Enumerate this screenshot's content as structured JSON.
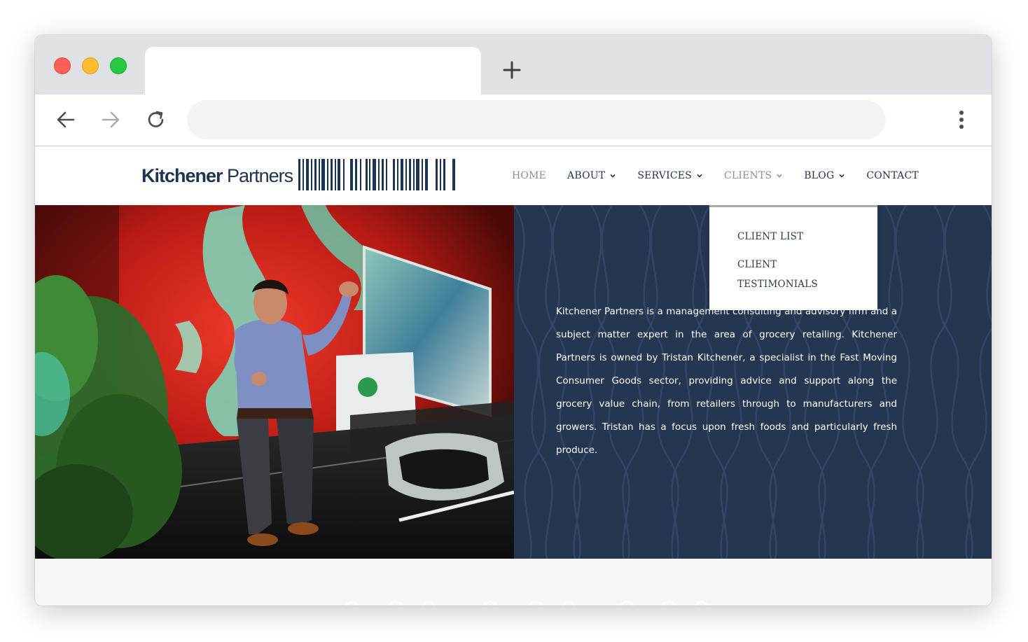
{
  "browser": {
    "new_tab_icon": "plus-icon",
    "back_icon": "arrow-left-icon",
    "forward_icon": "arrow-right-icon",
    "reload_icon": "reload-icon",
    "menu_icon": "kebab-menu-icon",
    "address_value": ""
  },
  "site": {
    "logo": {
      "bold": "Kitchener",
      "light": " Partners"
    },
    "nav": {
      "home": "HOME",
      "about": "ABOUT",
      "services": "SERVICES",
      "clients": "CLIENTS",
      "blog": "BLOG",
      "contact": "CONTACT"
    },
    "clients_dropdown": {
      "item1": "CLIENT LIST",
      "item2_line1": "CLIENT",
      "item2_line2": "TESTIMONIALS"
    },
    "about_text": "Kitchener Partners is a management consulting and advisory firm and a subject matter expert in the area of grocery retailing. Kitchener Partners is owned by Tristan Kitchener, a specialist in the Fast Moving Consumer Goods sector, providing advice and support along the grocery value chain, from retailers through to manufacturers and growers. Tristan has a focus upon fresh foods and particularly fresh produce."
  },
  "colors": {
    "brand_navy": "#1b3452",
    "panel_bg": "#243650",
    "section_bg": "#f8f6f5"
  }
}
